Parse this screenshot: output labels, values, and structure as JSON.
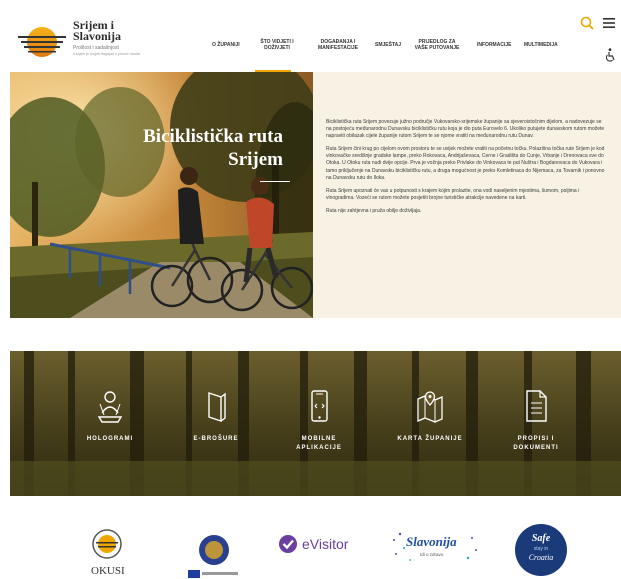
{
  "brand": {
    "title_line1": "Srijem i",
    "title_line2": "Slavonija",
    "subtitle": "Prošlost i sadašnjost",
    "tagline": "u kojem je čovjek tragajući u prirodi i okolici"
  },
  "nav": {
    "items": [
      {
        "label": "O ŽUPANIJI"
      },
      {
        "label": "ŠTO VIDJETI I DOŽIVJETI"
      },
      {
        "label": "DOGAĐANJA I MANIFESTACIJE"
      },
      {
        "label": "SMJEŠTAJ"
      },
      {
        "label": "PRIJEDLOG ZA VAŠE PUTOVANJE"
      },
      {
        "label": "INFORMACIJE"
      },
      {
        "label": "MULTIMEDIJA"
      }
    ],
    "active_color": "#f0a500"
  },
  "hero": {
    "title_line1": "Biciklistička ruta",
    "title_line2": "Srijem",
    "paragraphs": [
      "Biciklistička ruta Srijem povezuje južno područje Vukovarsko-srijemske županije sa sjeveroistočnim dijelom, a nadovezuje se na postojeću međunarodnu Dunavsku biciklističku rutu koja je dio puta Eurovelo 6. Ukoliko putujete dunavskom rutom možete napraviti obilazak cijele županije rutom Srijem te se njome vratiti na međunarodnu rutu Dunav.",
      "Ruta Srijem čini krug po cijelom ovom prostoru te se uvijek možete vratiti na početnu točku. Polazišna točka rute Srijem je kod vinkovačke središnje gradske lampe, preko Rokovaca, Andrijaševaca, Cerne i Gradišta do Cunje, Vrbanje i Drenovaca sve do Otoka. U Otoku ruta nudi dvije opcije. Prva je vožnja preko Privlake do Vinkovaca te put Nuštra i Bogdanovaca do Vukovara i tamo priključenje na Dunavsku biciklističku rutu, a druga mogućnost je preko Komletinaca do Nijemaca, za Tovarnik i ponovno na Dunavsku rutu do Iloka.",
      "Ruta Srijem upoznati će vas u potpunosti s krajem kojim prolazite, ona vodi naseljenim mjestima, šumom, poljima i vinogradima. Vozeći se rutom možete posjetiti brojne turističke atrakcije navedene na karti.",
      "Ruta nije zahtjevna i pruža obilje doživljaja."
    ],
    "bg_color": "#f7f2e4"
  },
  "services": [
    {
      "label_line1": "HOLOGRAMI",
      "label_line2": "",
      "icon": "hologram-icon"
    },
    {
      "label_line1": "E-BROŠURE",
      "label_line2": "",
      "icon": "brochure-icon"
    },
    {
      "label_line1": "MOBILNE",
      "label_line2": "APLIKACIJE",
      "icon": "mobile-app-icon"
    },
    {
      "label_line1": "KARTA ŽUPANIJE",
      "label_line2": "",
      "icon": "map-icon"
    },
    {
      "label_line1": "PROPISI I",
      "label_line2": "DOKUMENTI",
      "icon": "document-icon"
    }
  ],
  "partners": {
    "okusi": "OKUSI",
    "evisitor": "eVisitor",
    "slavonija": "Slavonija",
    "slavonija_sub": "Idi u zdravo",
    "safe_line1": "Safe",
    "safe_line2": "stay in",
    "safe_line3": "Croatia"
  },
  "colors": {
    "accent": "#f0a500",
    "evisitor_purple": "#6b3fa0",
    "safe_blue": "#1a3a7a"
  }
}
